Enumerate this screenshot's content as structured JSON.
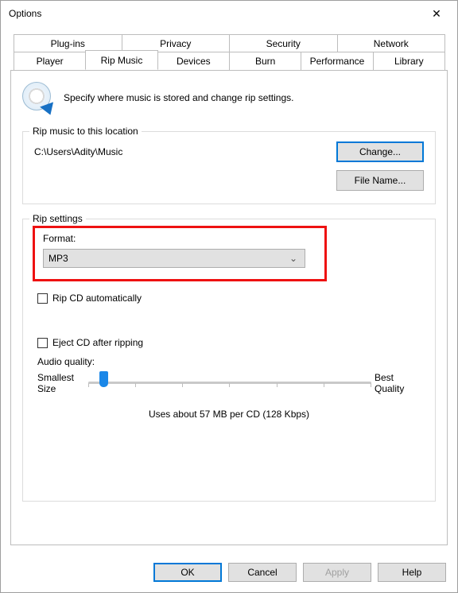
{
  "window": {
    "title": "Options"
  },
  "tabs": {
    "top": [
      "Plug-ins",
      "Privacy",
      "Security",
      "Network"
    ],
    "bottom": [
      "Player",
      "Rip Music",
      "Devices",
      "Burn",
      "Performance",
      "Library"
    ],
    "active": "Rip Music"
  },
  "header": {
    "text": "Specify where music is stored and change rip settings."
  },
  "location_group": {
    "legend": "Rip music to this location",
    "path": "C:\\Users\\Adity\\Music",
    "change_btn": "Change...",
    "filename_btn": "File Name..."
  },
  "settings_group": {
    "legend": "Rip settings",
    "format_label": "Format:",
    "format_value": "MP3",
    "rip_auto_label": "Rip CD automatically",
    "eject_label": "Eject CD after ripping",
    "aq_label": "Audio quality:",
    "aq_left1": "Smallest",
    "aq_left2": "Size",
    "aq_right1": "Best",
    "aq_right2": "Quality",
    "usage": "Uses about 57 MB per CD (128 Kbps)"
  },
  "buttons": {
    "ok": "OK",
    "cancel": "Cancel",
    "apply": "Apply",
    "help": "Help"
  }
}
